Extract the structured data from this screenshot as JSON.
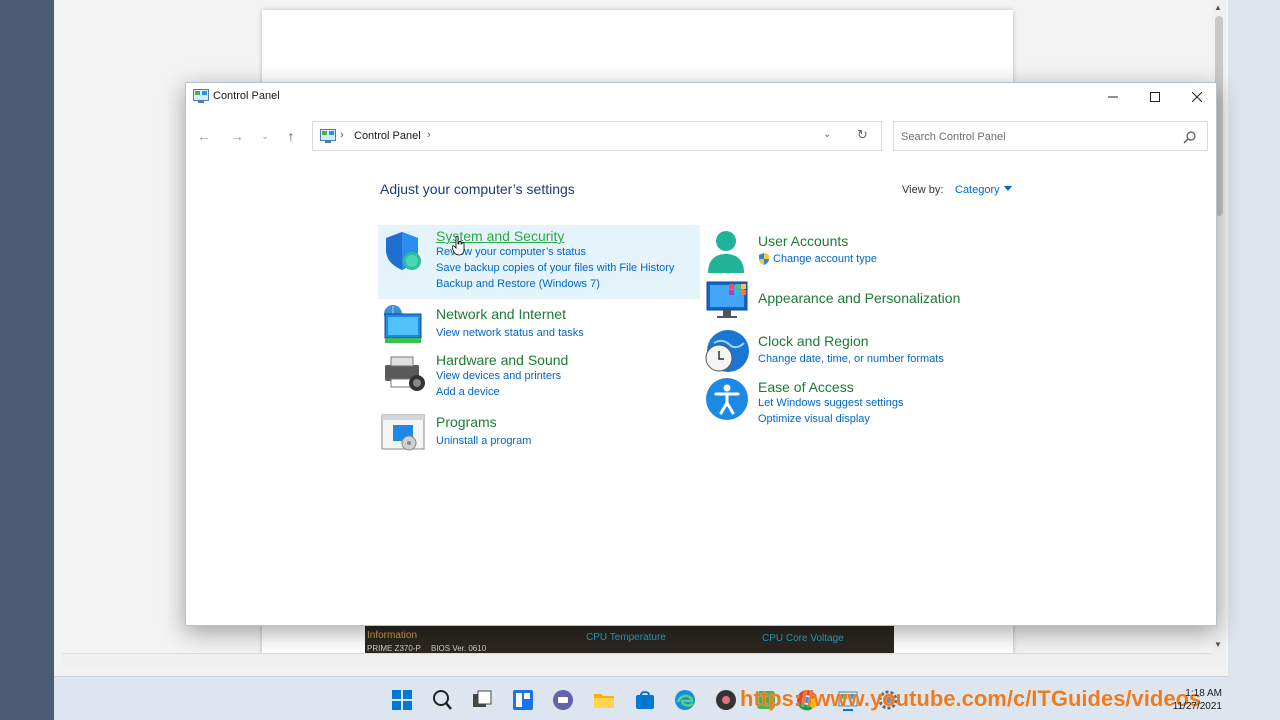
{
  "window": {
    "title": "Control Panel",
    "colors": {
      "link": "#0066cc",
      "category": "#1e7a32",
      "heading": "#1e3a78",
      "hover": "#e5f3fb"
    }
  },
  "address": {
    "path": "Control Panel",
    "separator": "›"
  },
  "search": {
    "placeholder": "Search Control Panel"
  },
  "main": {
    "heading": "Adjust your computer’s settings",
    "view_by_label": "View by:",
    "view_by_value": "Category"
  },
  "categories_left": [
    {
      "title": "System and Security",
      "links": [
        "Review your computer’s status",
        "Save backup copies of your files with File History",
        "Backup and Restore (Windows 7)"
      ]
    },
    {
      "title": "Network and Internet",
      "links": [
        "View network status and tasks"
      ]
    },
    {
      "title": "Hardware and Sound",
      "links": [
        "View devices and printers",
        "Add a device"
      ]
    },
    {
      "title": "Programs",
      "links": [
        "Uninstall a program"
      ]
    }
  ],
  "categories_right": [
    {
      "title": "User Accounts",
      "links": [
        "Change account type"
      ]
    },
    {
      "title": "Appearance and Personalization",
      "links": []
    },
    {
      "title": "Clock and Region",
      "links": [
        "Change date, time, or number formats"
      ]
    },
    {
      "title": "Ease of Access",
      "links": [
        "Let Windows suggest settings",
        "Optimize visual display"
      ]
    }
  ],
  "background_window": {
    "labels": [
      "Information",
      "CPU Temperature",
      "CPU Core Voltage",
      "PRIME Z370-P",
      "BIOS Ver. 0610"
    ]
  },
  "taskbar": {
    "icons": [
      "start-icon",
      "search-icon",
      "task-view-icon",
      "widgets-icon",
      "chat-icon",
      "file-explorer-icon",
      "store-icon",
      "edge-icon",
      "media-icon",
      "app-icon",
      "chrome-icon",
      "control-panel-icon",
      "settings-icon"
    ],
    "time": "1:18 AM",
    "date": "11/27/2021"
  },
  "watermark": "https://www.youtube.com/c/ITGuides/videos"
}
